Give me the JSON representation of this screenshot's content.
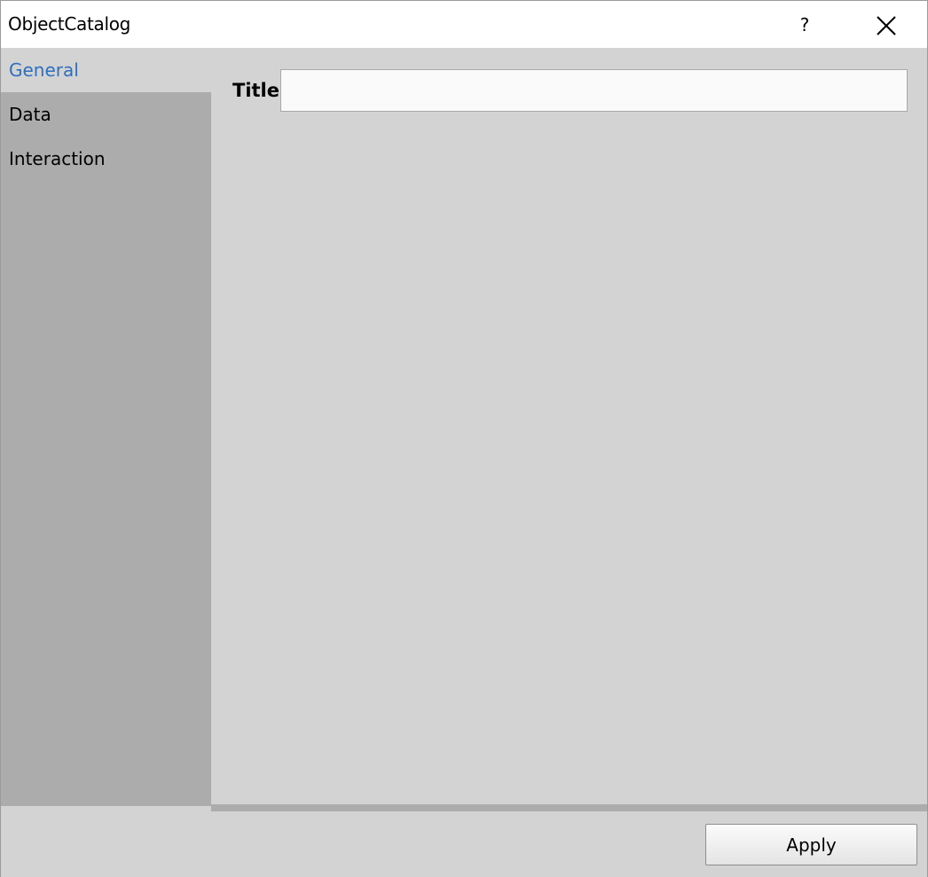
{
  "window": {
    "title": "ObjectCatalog",
    "help_label": "?",
    "close_icon": "close-icon"
  },
  "sidebar": {
    "items": [
      {
        "label": "General",
        "active": true
      },
      {
        "label": "Data",
        "active": false
      },
      {
        "label": "Interaction",
        "active": false
      }
    ],
    "active_color": "#2f6fbf"
  },
  "general": {
    "title_label": "Title",
    "title_value": "",
    "title_placeholder": ""
  },
  "footer": {
    "apply_label": "Apply"
  }
}
